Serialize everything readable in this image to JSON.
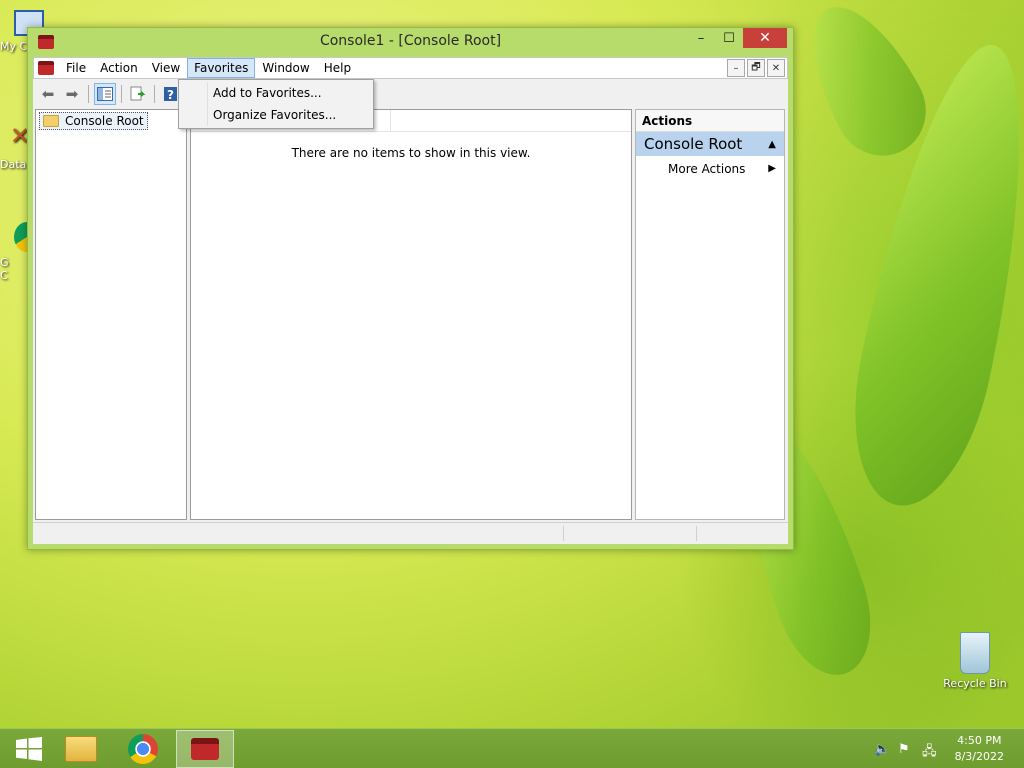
{
  "desktop": {
    "icons": [
      {
        "label": "My C"
      },
      {
        "label": "Data"
      },
      {
        "label": "G\nC"
      },
      {
        "label": "Recycle Bin"
      }
    ]
  },
  "window": {
    "title": "Console1 - [Console Root]",
    "controls": {
      "minimize": "–",
      "maximize": "☐",
      "close": "✕"
    }
  },
  "menu": {
    "items": [
      "File",
      "Action",
      "View",
      "Favorites",
      "Window",
      "Help"
    ],
    "active": "Favorites",
    "mdi": {
      "minimize": "–",
      "restore": "🗗",
      "close": "✕"
    }
  },
  "favorites_menu": {
    "items": [
      "Add to Favorites...",
      "Organize Favorites..."
    ]
  },
  "tree": {
    "root_label": "Console Root"
  },
  "center": {
    "empty_message": "There are no items to show in this view."
  },
  "actions_pane": {
    "header": "Actions",
    "section": "Console Root",
    "more_actions": "More Actions"
  },
  "taskbar": {
    "time": "4:50 PM",
    "date": "8/3/2022"
  }
}
